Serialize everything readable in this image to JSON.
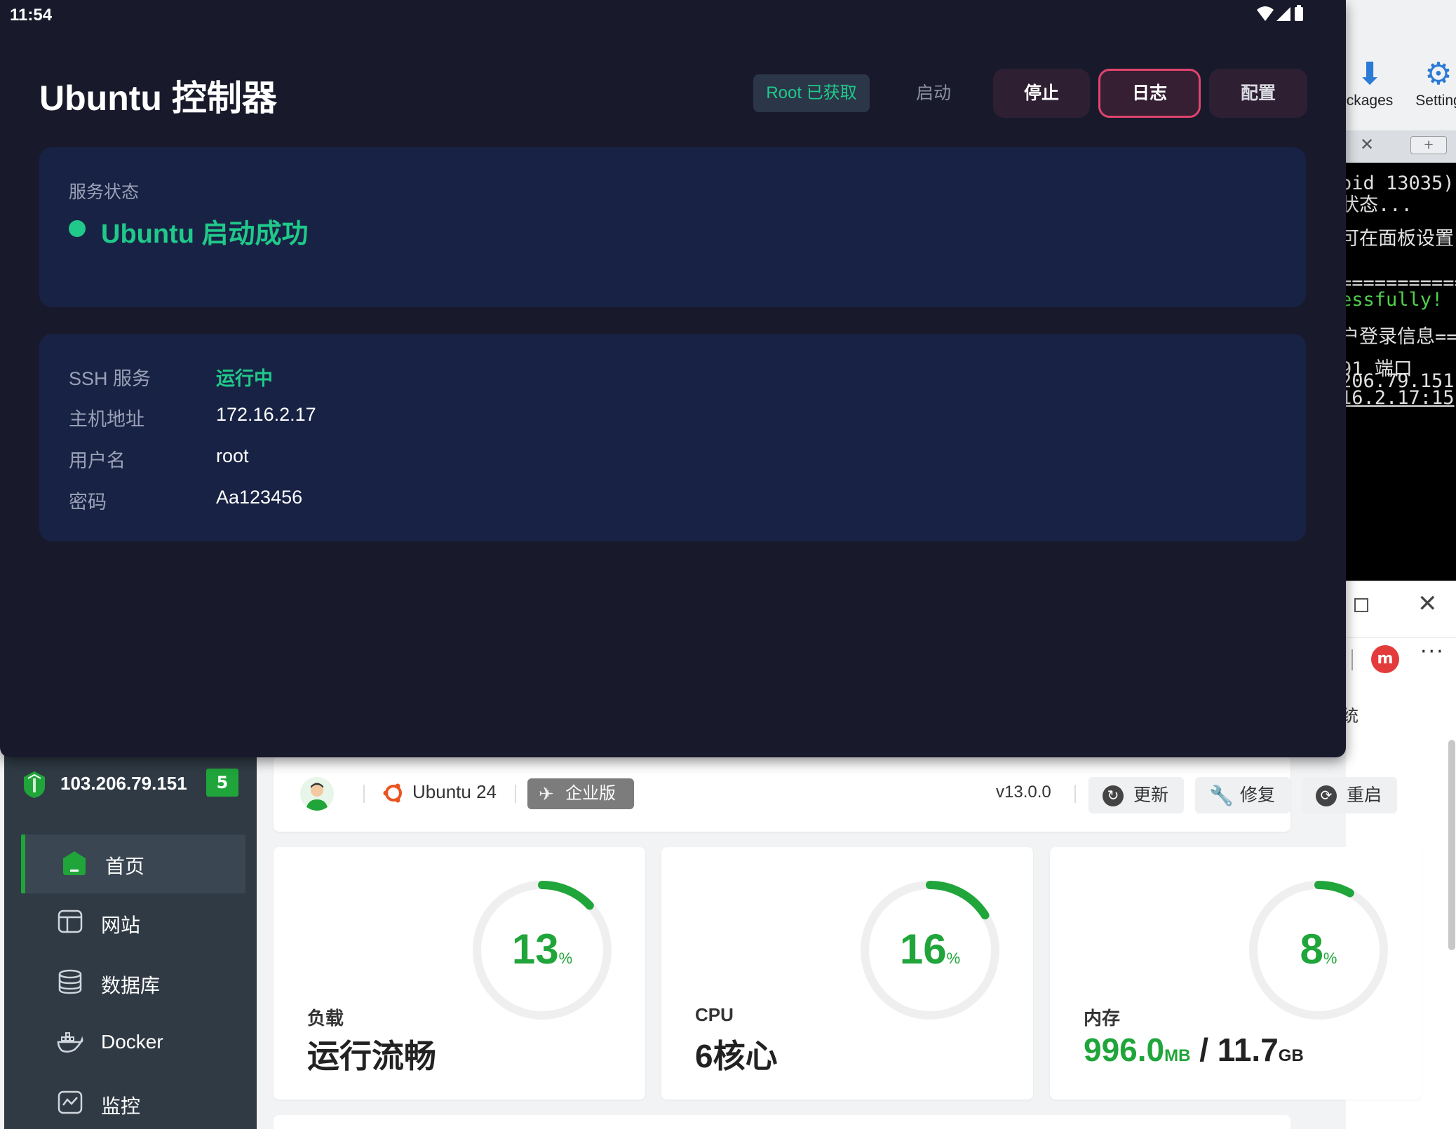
{
  "status_bar": {
    "time": "11:54"
  },
  "ubuntu_window": {
    "title": "Ubuntu 控制器",
    "root_badge": "Root 已获取",
    "buttons": {
      "start": "启动",
      "stop": "停止",
      "log": "日志",
      "config": "配置"
    },
    "service_status": {
      "label": "服务状态",
      "text": "Ubuntu 启动成功",
      "color": "#20c98a"
    },
    "ssh_info": [
      {
        "key": "SSH 服务",
        "value": "运行中"
      },
      {
        "key": "主机地址",
        "value": "172.16.2.17"
      },
      {
        "key": "用户名",
        "value": "root"
      },
      {
        "key": "密码",
        "value": "Aa123456"
      }
    ]
  },
  "background_app": {
    "toolbar": {
      "packages_label": "ckages",
      "settings_label": "Setting"
    },
    "terminal_lines": [
      {
        "text": "oid 13035)",
        "style": "normal"
      },
      {
        "text": "状态...",
        "style": "normal"
      },
      {
        "text": "可在面板设置",
        "style": "normal"
      },
      {
        "text": "============",
        "style": "normal"
      },
      {
        "text": "essfully!",
        "style": "green"
      },
      {
        "text": "户登录信息==",
        "style": "normal"
      },
      {
        "text": "91 端口",
        "style": "normal"
      },
      {
        "text": "206.79.151",
        "style": "normal"
      },
      {
        "text": "16.2.17:15",
        "style": "underline"
      }
    ],
    "browser_fragment": "统"
  },
  "panel": {
    "sidebar": {
      "ip": "103.206.79.151",
      "badge": "5",
      "items": [
        {
          "label": "首页",
          "icon": "home-icon"
        },
        {
          "label": "网站",
          "icon": "website-icon"
        },
        {
          "label": "数据库",
          "icon": "database-icon"
        },
        {
          "label": "Docker",
          "icon": "docker-icon"
        },
        {
          "label": "监控",
          "icon": "monitor-icon"
        }
      ]
    },
    "topbar": {
      "os": "Ubuntu 24",
      "edition": "企业版",
      "version": "v13.0.0",
      "buttons": {
        "update": "更新",
        "repair": "修复",
        "restart": "重启"
      }
    },
    "cards": {
      "load": {
        "percent": 13,
        "unit": "%",
        "label": "负载",
        "value": "运行流畅"
      },
      "cpu": {
        "percent": 16,
        "unit": "%",
        "label": "CPU",
        "value": "6核心"
      },
      "memory": {
        "percent": 8,
        "unit": "%",
        "label": "内存",
        "used": "996.0",
        "used_unit": "MB",
        "sep": " / ",
        "total": "11.7",
        "total_unit": "GB"
      }
    },
    "accent_color": "#20a53a"
  }
}
